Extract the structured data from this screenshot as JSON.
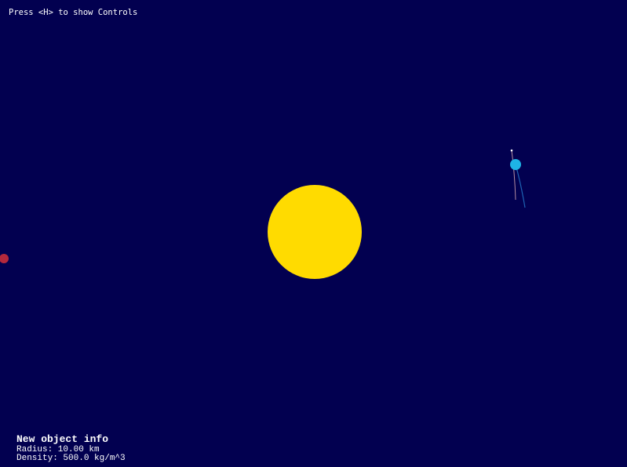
{
  "hud": {
    "hint": "Press <H> to show Controls"
  },
  "new_object_info": {
    "title": "New object info",
    "radius": "Radius: 10.00 km",
    "density": "Density: 500.0 kg/m^3"
  },
  "colors": {
    "background": "#020050",
    "sun": "#FFDB00",
    "planet_blue": "#1EB4E6",
    "planet_red": "#B4283C",
    "trail_blue": "#1E64B4",
    "trail_pink": "#B48CA0",
    "text": "#FFFFFF"
  }
}
